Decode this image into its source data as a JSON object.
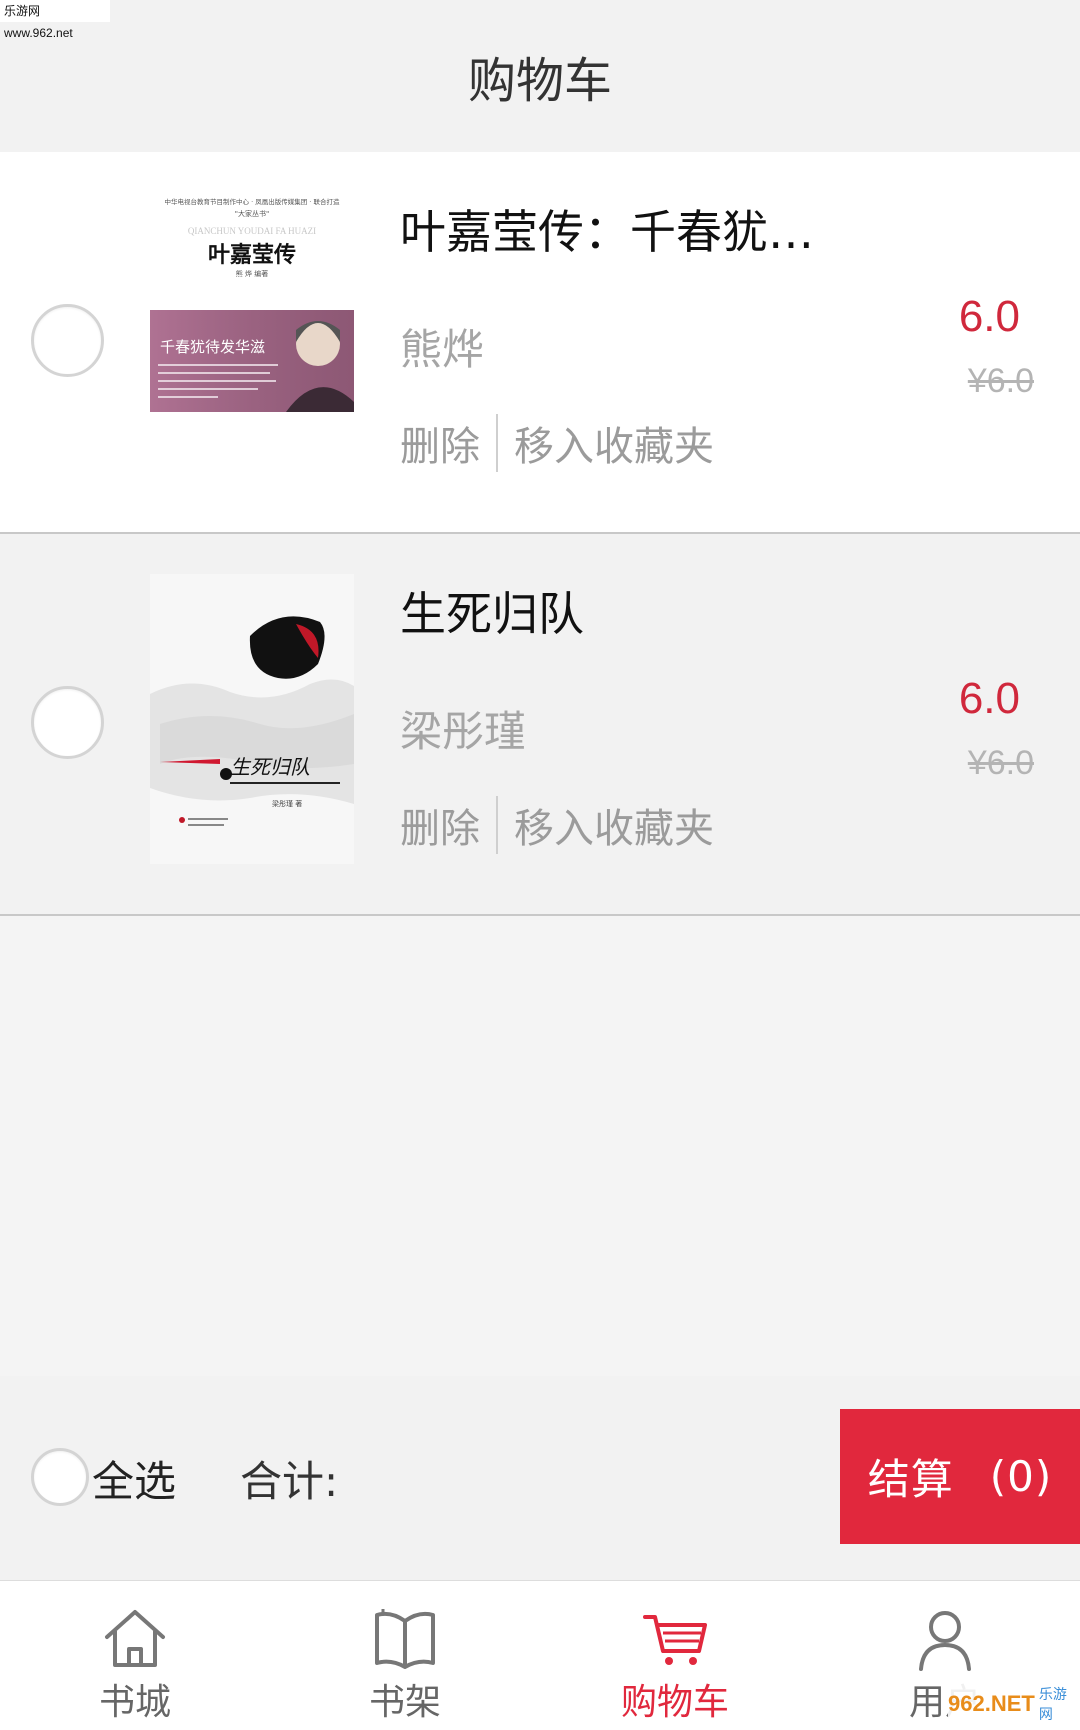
{
  "watermark": {
    "top_text": "乐游网 www.962.net",
    "bottom_logo": "962.NET",
    "bottom_sub": "乐游网"
  },
  "header": {
    "title": "购物车"
  },
  "cart": {
    "items": [
      {
        "title": "叶嘉莹传：千春犹…",
        "author": "熊烨",
        "price": "6.0",
        "original_price": "¥6.0",
        "delete_label": "删除",
        "move_label": "移入收藏夹",
        "cover": {
          "small_top": "中华电视台教育节目制作中心 · 凤凰出版传媒集团 · 联合打造",
          "series": "\"大家丛书\"",
          "pinyin": "QIANCHUN YOUDAI FA HUAZI",
          "book_title": "叶嘉莹传",
          "book_author": "熊 烨  编著",
          "subtitle": "千春犹待发华滋"
        }
      },
      {
        "title": "生死归队",
        "author": "梁彤瑾",
        "price": "6.0",
        "original_price": "¥6.0",
        "delete_label": "删除",
        "move_label": "移入收藏夹",
        "cover": {
          "calligraphy": "生死归队",
          "book_author": "梁彤瑾 著"
        }
      }
    ]
  },
  "summary": {
    "select_all_label": "全选",
    "total_label": "合计:",
    "checkout_label": "结算",
    "checkout_count": "(0)"
  },
  "tabs": [
    {
      "label": "书城",
      "icon": "home-icon",
      "active": false
    },
    {
      "label": "书架",
      "icon": "open-book-icon",
      "active": false
    },
    {
      "label": "购物车",
      "icon": "cart-icon",
      "active": true
    },
    {
      "label": "用户",
      "icon": "user-icon",
      "active": false
    }
  ],
  "colors": {
    "accent": "#e1283d",
    "price": "#d0283c",
    "muted": "#9b9b9b"
  }
}
